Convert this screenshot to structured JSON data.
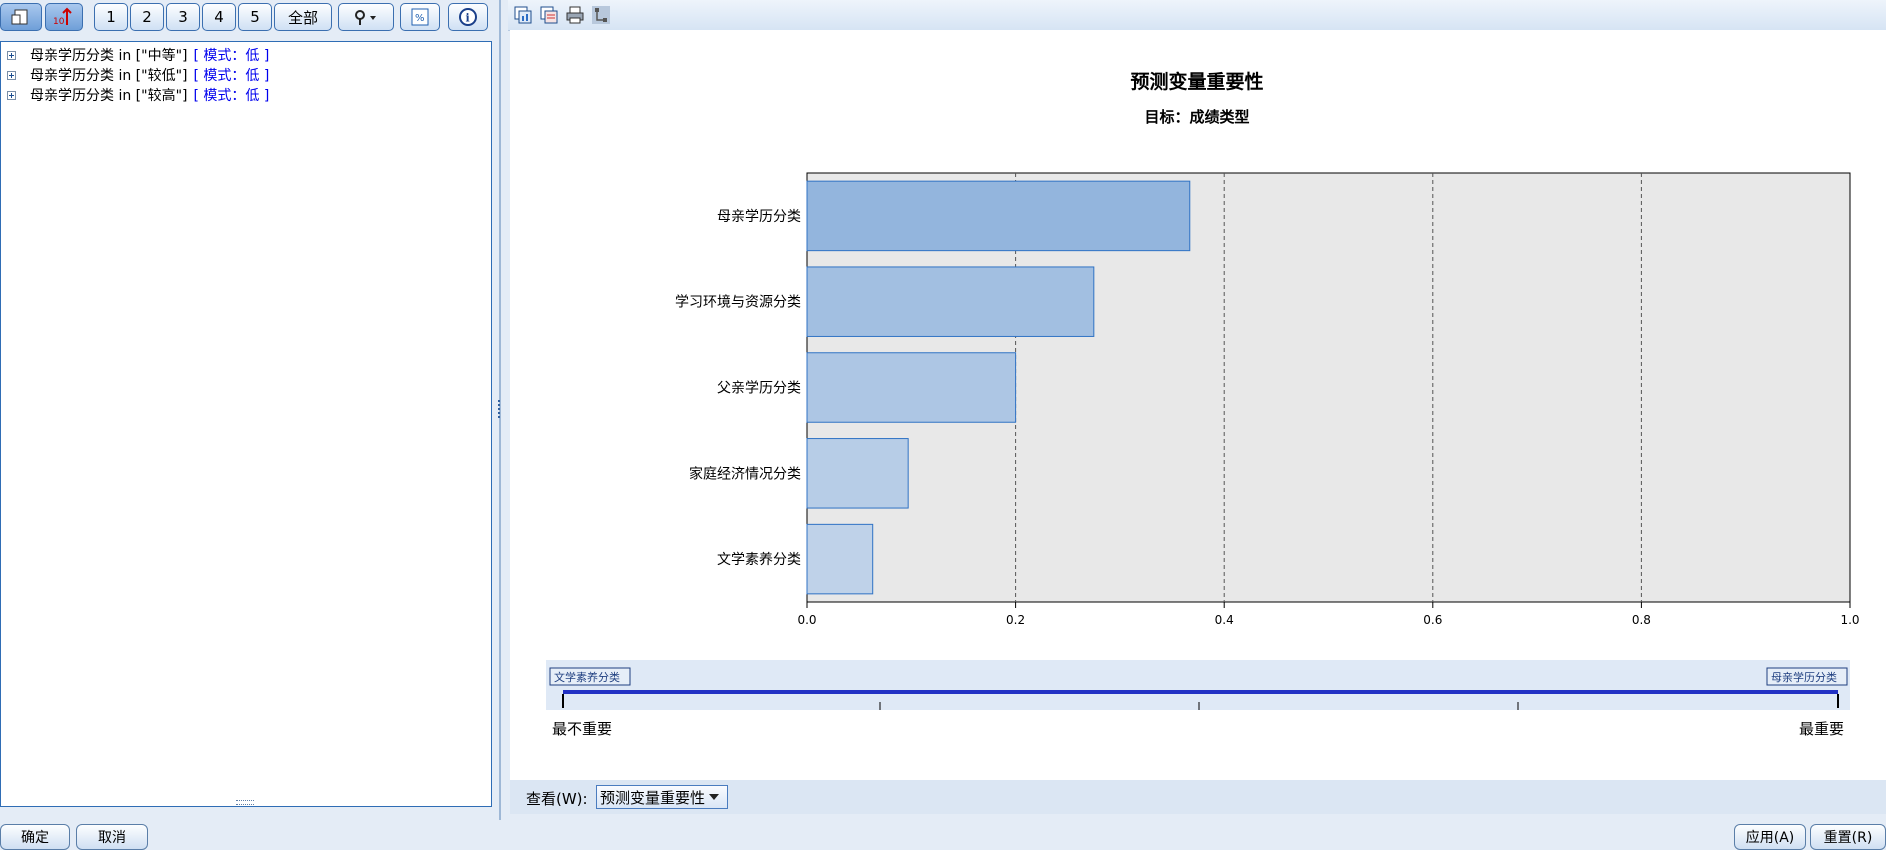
{
  "toolbar": {
    "buttons": [
      "1",
      "2",
      "3",
      "4",
      "5",
      "全部"
    ]
  },
  "tree": {
    "rows": [
      {
        "label": "母亲学历分类 in [\"中等\"]",
        "mode": "[ 模式：低 ]"
      },
      {
        "label": "母亲学历分类 in [\"较低\"]",
        "mode": "[ 模式：低 ]"
      },
      {
        "label": "母亲学历分类 in [\"较高\"]",
        "mode": "[ 模式：低 ]"
      }
    ]
  },
  "chart_data": {
    "type": "bar",
    "orientation": "horizontal",
    "title": "预测变量重要性",
    "subtitle": "目标：成绩类型",
    "categories": [
      "母亲学历分类",
      "学习环境与资源分类",
      "父亲学历分类",
      "家庭经济情况分类",
      "文学素养分类"
    ],
    "values": [
      0.367,
      0.275,
      0.2,
      0.097,
      0.063
    ],
    "xlim": [
      0.0,
      1.0
    ],
    "xticks": [
      "0.0",
      "0.2",
      "0.4",
      "0.6",
      "0.8",
      "1.0"
    ],
    "grid": true,
    "colors": [
      "#93b5dd",
      "#a2bfe1",
      "#adc6e4",
      "#b7cde7",
      "#bfd2e9"
    ]
  },
  "slider": {
    "left_tag": "文学素养分类",
    "right_tag": "母亲学历分类",
    "left_label": "最不重要",
    "right_label": "最重要"
  },
  "view": {
    "label": "查看(W):",
    "selected": "预测变量重要性"
  },
  "buttons": {
    "ok": "确定",
    "cancel": "取消",
    "apply": "应用(A)",
    "reset": "重置(R)"
  }
}
